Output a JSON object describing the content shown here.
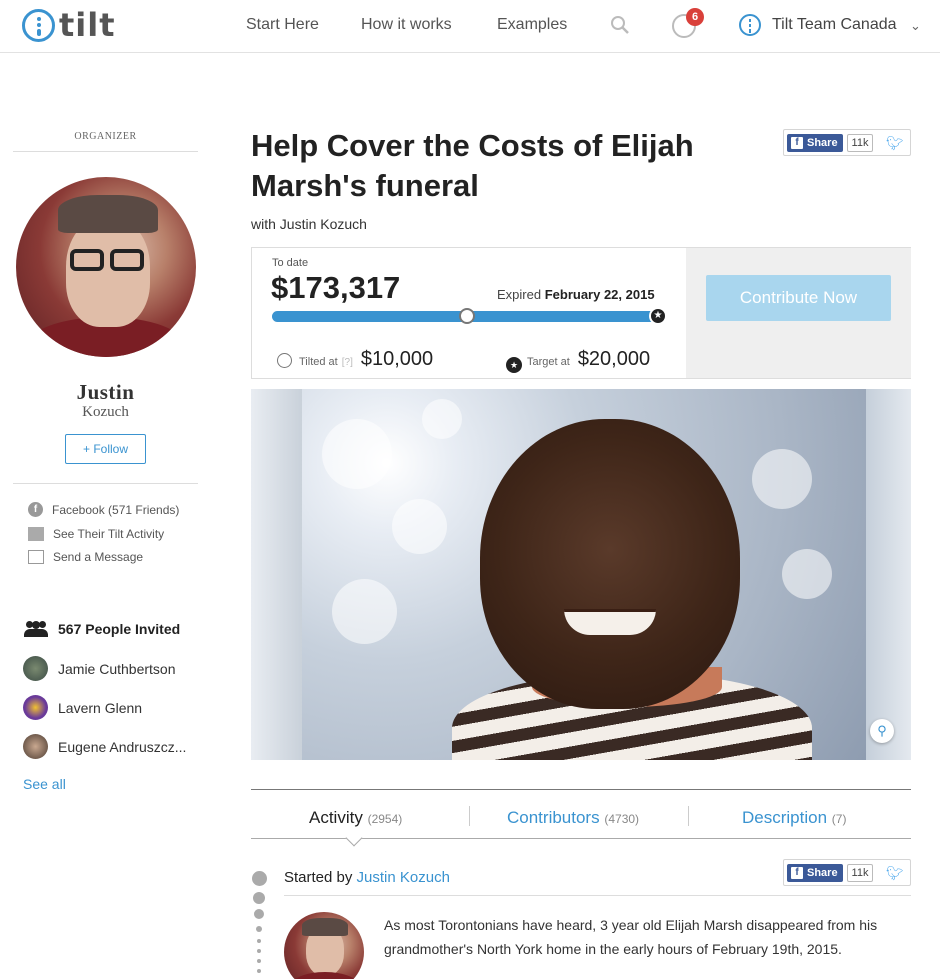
{
  "header": {
    "logo_text": "tilt",
    "nav": [
      "Start Here",
      "How it works",
      "Examples"
    ],
    "notification_count": "6",
    "user_name": "Tilt Team Canada",
    "icons": [
      "tilt-logo-icon",
      "search-icon",
      "globe-icon",
      "tilt-user-icon",
      "chevron-down-icon"
    ]
  },
  "sidebar": {
    "organizer_label": "ORGANIZER",
    "first_name": "Justin",
    "last_name": "Kozuch",
    "follow_label": "+ Follow",
    "links": [
      {
        "label": "Facebook (571 Friends)",
        "icon": "facebook-icon"
      },
      {
        "label": "See Their Tilt Activity",
        "icon": "activity-icon"
      },
      {
        "label": "Send a Message",
        "icon": "envelope-icon"
      }
    ],
    "invited": "567 People Invited",
    "people": [
      "Jamie Cuthbertson",
      "Lavern Glenn",
      "Eugene Andruszcz..."
    ],
    "see_all": "See all"
  },
  "campaign": {
    "title": "Help Cover the Costs of Elijah Marsh's funeral",
    "with_text": "with Justin Kozuch",
    "to_date_label": "To date",
    "amount": "$173,317",
    "expired_label": "Expired",
    "expired_date": "February 22, 2015",
    "tilted_label": "Tilted at",
    "tilted_question": "[?]",
    "tilted_amount": "$10,000",
    "target_label": "Target at",
    "target_amount": "$20,000",
    "progress_fraction": 1.0,
    "tilt_fraction": 0.5,
    "contribute_label": "Contribute Now"
  },
  "share": {
    "fb_label": "Share",
    "fb_count": "11k"
  },
  "tabs": [
    {
      "label": "Activity",
      "count": "(2954)"
    },
    {
      "label": "Contributors",
      "count": "(4730)"
    },
    {
      "label": "Description",
      "count": "(7)"
    }
  ],
  "activity": {
    "started_by": "Started by",
    "author": "Justin Kozuch",
    "story": "As most Torontonians have heard, 3 year old Elijah Marsh disappeared from his grandmother's North York home in the early hours of February 19th, 2015."
  },
  "colors": {
    "accent": "#3a93d0",
    "contribute_button": "#a9d6ee",
    "badge": "#d9403a",
    "facebook": "#3b5998",
    "twitter": "#55acee"
  }
}
